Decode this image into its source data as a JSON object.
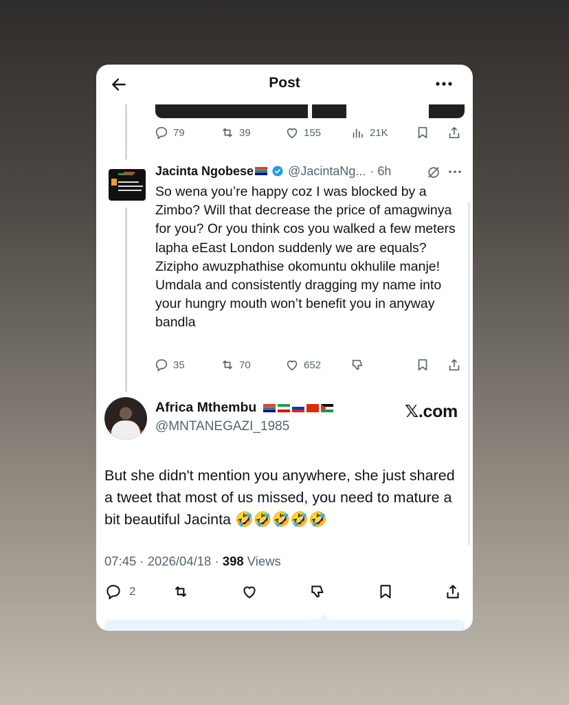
{
  "header": {
    "title": "Post"
  },
  "post1": {
    "replies": "79",
    "reposts": "39",
    "likes": "155",
    "views": "21K"
  },
  "post2": {
    "name": "Jacinta Ngobese",
    "handle": "@JacintaNg...",
    "time": "· 6h",
    "body": "So wena you’re happy coz I was blocked by a Zimbo? Will that decrease the price of amagwinya for you? Or you think cos you walked a few meters lapha eEast London suddenly we are equals? Zizipho awuzphathise okomuntu okhulile manje! Umdala and consistently dragging my name into your hungry mouth won’t benefit you in anyway bandla",
    "replies": "35",
    "reposts": "70",
    "likes": "652"
  },
  "post3": {
    "name": "Africa Mthembu",
    "handle": "@MNTANEGAZI_1985",
    "watermark": "𝕏.com",
    "body": "But she didn't mention you anywhere, she just shared a tweet that most of us missed, you need to mature a bit beautiful Jacinta 🤣🤣🤣🤣🤣",
    "time": "07:45 · 2026/04/18 · ",
    "views_count": "398",
    "views_label": " Views",
    "replies": "2"
  },
  "colors": {
    "text": "#0f1419",
    "muted": "#536471",
    "accent": "#1d9bf0"
  }
}
